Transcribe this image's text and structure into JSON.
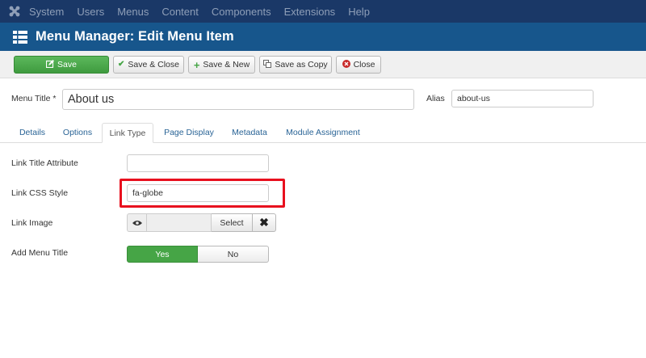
{
  "topnav": {
    "items": [
      "System",
      "Users",
      "Menus",
      "Content",
      "Components",
      "Extensions",
      "Help"
    ]
  },
  "header": {
    "title": "Menu Manager: Edit Menu Item"
  },
  "toolbar": {
    "save": "Save",
    "save_close": "Save & Close",
    "save_new": "Save & New",
    "save_copy": "Save as Copy",
    "close": "Close"
  },
  "form": {
    "menu_title_label": "Menu Title *",
    "menu_title_value": "About us",
    "alias_label": "Alias",
    "alias_value": "about-us"
  },
  "tabs": [
    "Details",
    "Options",
    "Link Type",
    "Page Display",
    "Metadata",
    "Module Assignment"
  ],
  "active_tab": "Link Type",
  "link_type": {
    "title_attr_label": "Link Title Attribute",
    "title_attr_value": "",
    "css_style_label": "Link CSS Style",
    "css_style_value": "fa-globe",
    "image_label": "Link Image",
    "image_select": "Select",
    "add_title_label": "Add Menu Title",
    "add_title_yes": "Yes",
    "add_title_no": "No"
  },
  "colors": {
    "topnav_bg": "#1a3867",
    "subhead_bg": "#17568c",
    "save_green": "#46a546",
    "highlight_red": "#e8101e",
    "link_blue": "#2a6496"
  },
  "icons": {
    "logo": "joomla-logo-icon",
    "header": "menu-list-icon",
    "save": "edit-icon",
    "save_close": "check-icon",
    "save_new": "plus-icon",
    "save_copy": "copy-icon",
    "close": "cancel-circle-icon",
    "image_preview": "eye-icon",
    "image_clear": "close-icon"
  }
}
